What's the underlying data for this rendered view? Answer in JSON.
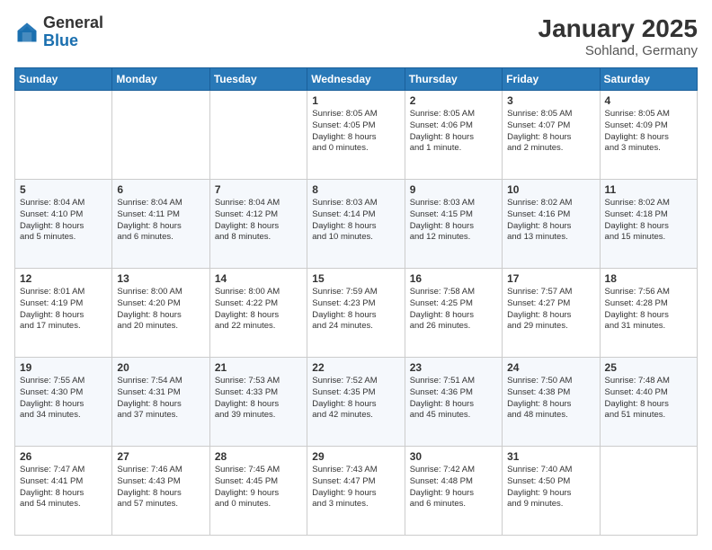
{
  "header": {
    "logo_general": "General",
    "logo_blue": "Blue",
    "title": "January 2025",
    "subtitle": "Sohland, Germany"
  },
  "weekdays": [
    "Sunday",
    "Monday",
    "Tuesday",
    "Wednesday",
    "Thursday",
    "Friday",
    "Saturday"
  ],
  "weeks": [
    [
      {
        "day": "",
        "info": ""
      },
      {
        "day": "",
        "info": ""
      },
      {
        "day": "",
        "info": ""
      },
      {
        "day": "1",
        "info": "Sunrise: 8:05 AM\nSunset: 4:05 PM\nDaylight: 8 hours\nand 0 minutes."
      },
      {
        "day": "2",
        "info": "Sunrise: 8:05 AM\nSunset: 4:06 PM\nDaylight: 8 hours\nand 1 minute."
      },
      {
        "day": "3",
        "info": "Sunrise: 8:05 AM\nSunset: 4:07 PM\nDaylight: 8 hours\nand 2 minutes."
      },
      {
        "day": "4",
        "info": "Sunrise: 8:05 AM\nSunset: 4:09 PM\nDaylight: 8 hours\nand 3 minutes."
      }
    ],
    [
      {
        "day": "5",
        "info": "Sunrise: 8:04 AM\nSunset: 4:10 PM\nDaylight: 8 hours\nand 5 minutes."
      },
      {
        "day": "6",
        "info": "Sunrise: 8:04 AM\nSunset: 4:11 PM\nDaylight: 8 hours\nand 6 minutes."
      },
      {
        "day": "7",
        "info": "Sunrise: 8:04 AM\nSunset: 4:12 PM\nDaylight: 8 hours\nand 8 minutes."
      },
      {
        "day": "8",
        "info": "Sunrise: 8:03 AM\nSunset: 4:14 PM\nDaylight: 8 hours\nand 10 minutes."
      },
      {
        "day": "9",
        "info": "Sunrise: 8:03 AM\nSunset: 4:15 PM\nDaylight: 8 hours\nand 12 minutes."
      },
      {
        "day": "10",
        "info": "Sunrise: 8:02 AM\nSunset: 4:16 PM\nDaylight: 8 hours\nand 13 minutes."
      },
      {
        "day": "11",
        "info": "Sunrise: 8:02 AM\nSunset: 4:18 PM\nDaylight: 8 hours\nand 15 minutes."
      }
    ],
    [
      {
        "day": "12",
        "info": "Sunrise: 8:01 AM\nSunset: 4:19 PM\nDaylight: 8 hours\nand 17 minutes."
      },
      {
        "day": "13",
        "info": "Sunrise: 8:00 AM\nSunset: 4:20 PM\nDaylight: 8 hours\nand 20 minutes."
      },
      {
        "day": "14",
        "info": "Sunrise: 8:00 AM\nSunset: 4:22 PM\nDaylight: 8 hours\nand 22 minutes."
      },
      {
        "day": "15",
        "info": "Sunrise: 7:59 AM\nSunset: 4:23 PM\nDaylight: 8 hours\nand 24 minutes."
      },
      {
        "day": "16",
        "info": "Sunrise: 7:58 AM\nSunset: 4:25 PM\nDaylight: 8 hours\nand 26 minutes."
      },
      {
        "day": "17",
        "info": "Sunrise: 7:57 AM\nSunset: 4:27 PM\nDaylight: 8 hours\nand 29 minutes."
      },
      {
        "day": "18",
        "info": "Sunrise: 7:56 AM\nSunset: 4:28 PM\nDaylight: 8 hours\nand 31 minutes."
      }
    ],
    [
      {
        "day": "19",
        "info": "Sunrise: 7:55 AM\nSunset: 4:30 PM\nDaylight: 8 hours\nand 34 minutes."
      },
      {
        "day": "20",
        "info": "Sunrise: 7:54 AM\nSunset: 4:31 PM\nDaylight: 8 hours\nand 37 minutes."
      },
      {
        "day": "21",
        "info": "Sunrise: 7:53 AM\nSunset: 4:33 PM\nDaylight: 8 hours\nand 39 minutes."
      },
      {
        "day": "22",
        "info": "Sunrise: 7:52 AM\nSunset: 4:35 PM\nDaylight: 8 hours\nand 42 minutes."
      },
      {
        "day": "23",
        "info": "Sunrise: 7:51 AM\nSunset: 4:36 PM\nDaylight: 8 hours\nand 45 minutes."
      },
      {
        "day": "24",
        "info": "Sunrise: 7:50 AM\nSunset: 4:38 PM\nDaylight: 8 hours\nand 48 minutes."
      },
      {
        "day": "25",
        "info": "Sunrise: 7:48 AM\nSunset: 4:40 PM\nDaylight: 8 hours\nand 51 minutes."
      }
    ],
    [
      {
        "day": "26",
        "info": "Sunrise: 7:47 AM\nSunset: 4:41 PM\nDaylight: 8 hours\nand 54 minutes."
      },
      {
        "day": "27",
        "info": "Sunrise: 7:46 AM\nSunset: 4:43 PM\nDaylight: 8 hours\nand 57 minutes."
      },
      {
        "day": "28",
        "info": "Sunrise: 7:45 AM\nSunset: 4:45 PM\nDaylight: 9 hours\nand 0 minutes."
      },
      {
        "day": "29",
        "info": "Sunrise: 7:43 AM\nSunset: 4:47 PM\nDaylight: 9 hours\nand 3 minutes."
      },
      {
        "day": "30",
        "info": "Sunrise: 7:42 AM\nSunset: 4:48 PM\nDaylight: 9 hours\nand 6 minutes."
      },
      {
        "day": "31",
        "info": "Sunrise: 7:40 AM\nSunset: 4:50 PM\nDaylight: 9 hours\nand 9 minutes."
      },
      {
        "day": "",
        "info": ""
      }
    ]
  ]
}
